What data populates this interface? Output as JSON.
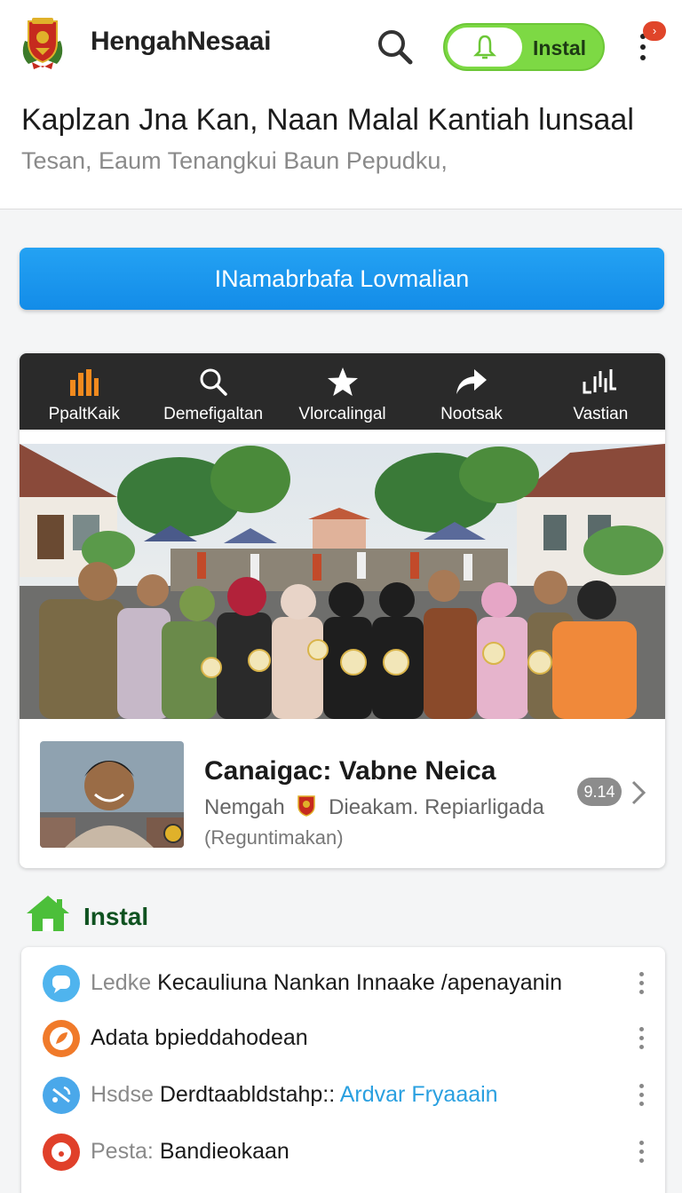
{
  "header": {
    "app_name": "HengahNesaai",
    "install_label": "Instal",
    "notif_badge": "›",
    "headline": "Kaplzan Jna Kan, Naan Malal Kantiah lunsaal",
    "subline": "Tesan, Eaum Tenangkui Baun Pepudku,"
  },
  "cta": {
    "label": "INamabrbafa Lovmalian"
  },
  "toolbar": {
    "items": [
      {
        "label": "PpaltKaik",
        "icon": "bar-chart-icon"
      },
      {
        "label": "Demefigaltan",
        "icon": "search-icon"
      },
      {
        "label": "Vlorcalingal",
        "icon": "star-icon"
      },
      {
        "label": "Nootsak",
        "icon": "share-icon"
      },
      {
        "label": "Vastian",
        "icon": "waveform-icon"
      }
    ]
  },
  "profile": {
    "title": "Canaigac: Vabne Neica",
    "meta_left": "Nemgah",
    "meta_right": "Dieakam. Repiarligada",
    "sub": "(Reguntimakan)",
    "count": "9.14"
  },
  "section": {
    "title": "Instal",
    "icon": "house-icon",
    "rows": [
      {
        "prefix": "Ledke",
        "text": " Kecauliuna Nankan Innaake /apenayanin",
        "link": "",
        "icon": "chat-bubble-icon",
        "color": "#4fb4ee"
      },
      {
        "prefix": "",
        "text": "Adata bpieddahodean",
        "link": "",
        "icon": "leaf-icon",
        "color": "#f07a2a"
      },
      {
        "prefix": "Hsdse",
        "text": " Derdtaabldstahp::",
        "link": " Ardvar Fryaaain",
        "icon": "antenna-icon",
        "color": "#4aa8ea"
      },
      {
        "prefix": "Pesta:",
        "text": " Bandieokaan",
        "link": "",
        "icon": "record-icon",
        "color": "#e0402a"
      }
    ]
  },
  "colors": {
    "accent_blue": "#1996ec",
    "install_green": "#7dd944",
    "toolbar_dark": "#2a2a2a",
    "section_green": "#0f5220"
  }
}
